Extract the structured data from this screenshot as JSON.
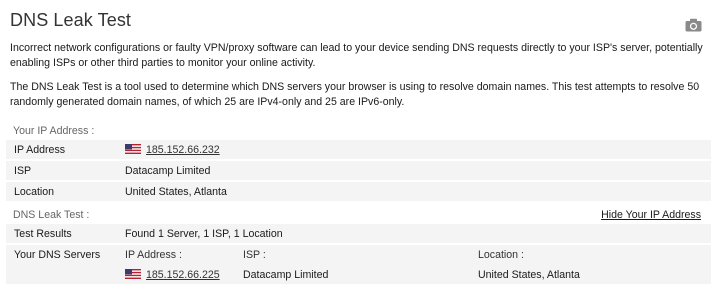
{
  "title": "DNS Leak Test",
  "camera_icon": "camera-icon",
  "paragraphs": [
    "Incorrect network configurations or faulty VPN/proxy software can lead to your device sending DNS requests directly to your ISP's server, potentially enabling ISPs or other third parties to monitor your online activity.",
    "The DNS Leak Test is a tool used to determine which DNS servers your browser is using to resolve domain names. This test attempts to resolve 50 randomly generated domain names, of which 25 are IPv4-only and 25 are IPv6-only."
  ],
  "your_ip": {
    "section_label": "Your IP Address :",
    "rows": [
      {
        "label": "IP Address",
        "value": "185.152.66.232"
      },
      {
        "label": "ISP",
        "value": "Datacamp Limited"
      },
      {
        "label": "Location",
        "value": "United States, Atlanta"
      }
    ]
  },
  "dns_leak": {
    "section_label": "DNS Leak Test :",
    "hide_link": "Hide Your IP Address",
    "results_label": "Test Results",
    "results_value": "Found 1 Server, 1 ISP, 1 Location",
    "servers_label": "Your DNS Servers",
    "columns": {
      "ip": "IP Address :",
      "isp": "ISP :",
      "location": "Location :"
    },
    "servers": [
      {
        "ip": "185.152.66.225",
        "isp": "Datacamp Limited",
        "location": "United States, Atlanta"
      }
    ]
  }
}
